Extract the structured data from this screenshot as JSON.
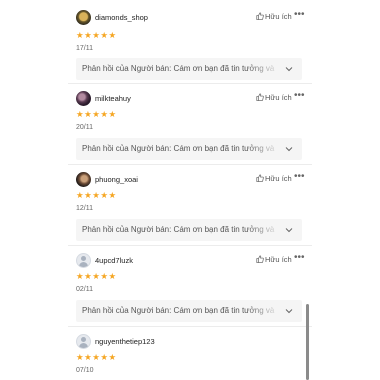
{
  "reviews": [
    {
      "username": "diamonds_shop",
      "helpful": "Hữu ích",
      "more": "•••",
      "stars": "★★★★★",
      "date": "17/11",
      "reply": "Phản hồi của Người bán: Cám ơn bạn đã tin tưởng và"
    },
    {
      "username": "milkteahuy",
      "helpful": "Hữu ích",
      "more": "•••",
      "stars": "★★★★★",
      "date": "20/11",
      "reply": "Phản hồi của Người bán: Cám ơn bạn đã tin tưởng và"
    },
    {
      "username": "phuong_xoai",
      "helpful": "Hữu ích",
      "more": "•••",
      "stars": "★★★★★",
      "date": "12/11",
      "reply": "Phản hồi của Người bán: Cám ơn bạn đã tin tưởng và"
    },
    {
      "username": "4upcd7luzk",
      "helpful": "Hữu ích",
      "more": "•••",
      "stars": "★★★★★",
      "date": "02/11",
      "reply": "Phản hồi của Người bán: Cám ơn bạn đã tin tưởng và"
    },
    {
      "username": "nguyenthetiep123",
      "helpful": "Hữu ích",
      "more": "•••",
      "stars": "★★★★★",
      "date": "07/10",
      "reply": ""
    }
  ],
  "colors": {
    "star": "#f5a623",
    "reply_bg": "#f5f5f5",
    "divider": "#ececec"
  }
}
